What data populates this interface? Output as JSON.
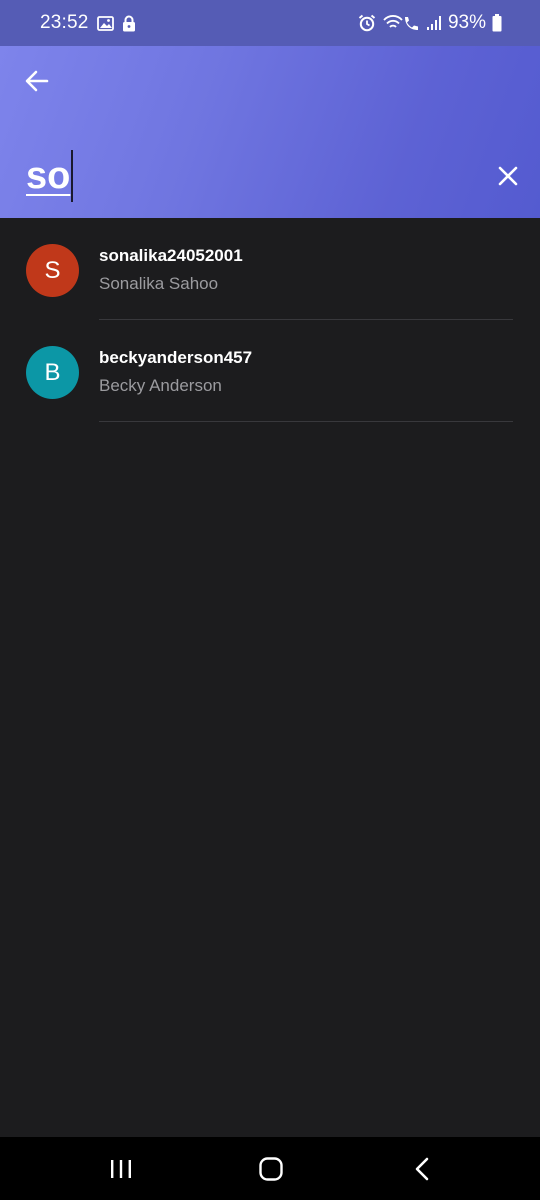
{
  "status_bar": {
    "time": "23:52",
    "battery": "93%",
    "icons": [
      "gallery-icon",
      "lock-icon",
      "alarm-icon",
      "wifi-call-icon",
      "signal-icon",
      "battery-icon"
    ]
  },
  "header": {
    "back_icon": "arrow-left-icon",
    "search_value": "so",
    "clear_icon": "close-icon",
    "gradient_colors": [
      "#7f85ec",
      "#545bd0"
    ]
  },
  "results": [
    {
      "initial": "S",
      "username": "sonalika24052001",
      "name": "Sonalika Sahoo",
      "avatar_color": "#c0381a"
    },
    {
      "initial": "B",
      "username": "beckyanderson457",
      "name": "Becky Anderson",
      "avatar_color": "#0c97a6"
    }
  ],
  "nav_bar": {
    "recents_icon": "recents-icon",
    "home_icon": "home-icon",
    "back_icon": "back-chevron-icon"
  }
}
